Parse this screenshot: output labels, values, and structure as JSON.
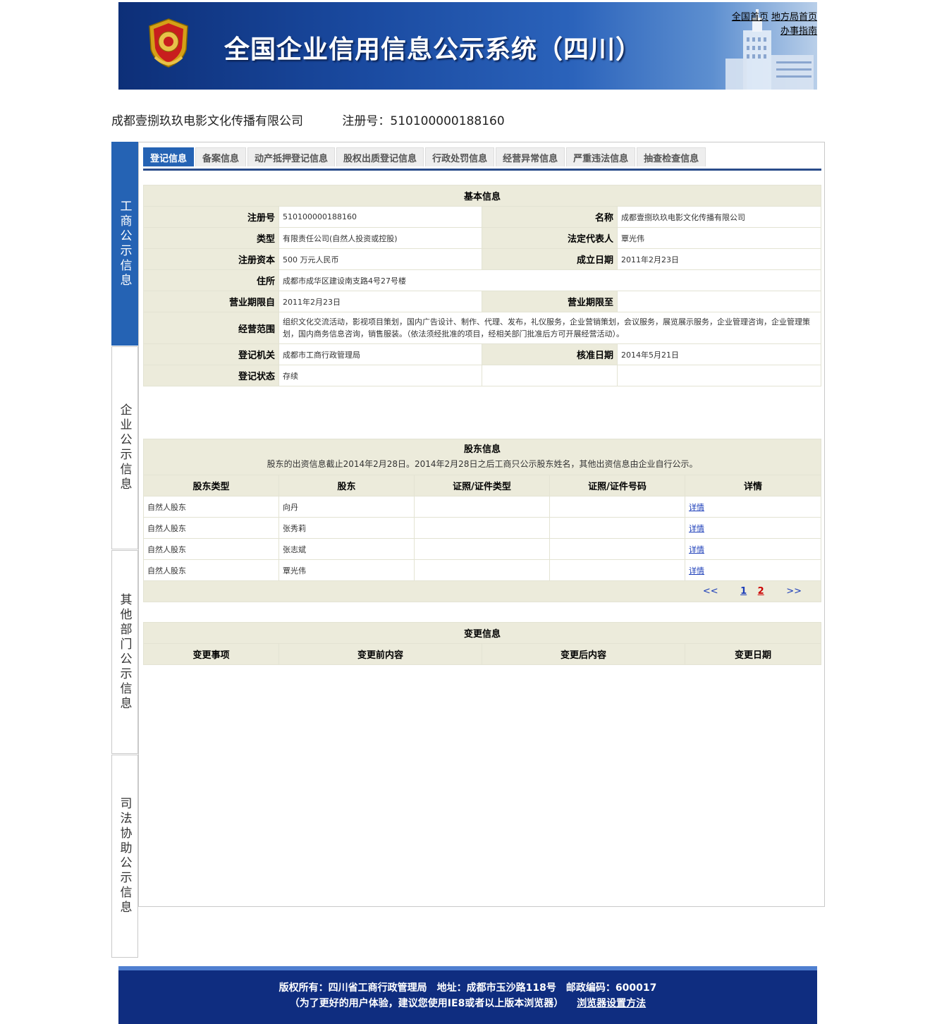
{
  "header": {
    "title": "全国企业信用信息公示系统（四川）",
    "links": [
      "全国首页",
      "地方局首页",
      "办事指南"
    ]
  },
  "company": {
    "name": "成都壹捌玖玖电影文化传播有限公司",
    "reg_label": "注册号：510100000188160"
  },
  "left_tabs": [
    "工商公示信息",
    "企业公示信息",
    "其他部门公示信息",
    "司法协助公示信息"
  ],
  "tabs": [
    "登记信息",
    "备案信息",
    "动产抵押登记信息",
    "股权出质登记信息",
    "行政处罚信息",
    "经营异常信息",
    "严重违法信息",
    "抽查检查信息"
  ],
  "basic": {
    "title": "基本信息",
    "reg_no_label": "注册号",
    "reg_no": "510100000188160",
    "name_label": "名称",
    "name": "成都壹捌玖玖电影文化传播有限公司",
    "type_label": "类型",
    "type": "有限责任公司(自然人投资或控股)",
    "legal_label": "法定代表人",
    "legal": "覃光伟",
    "capital_label": "注册资本",
    "capital": "500 万元人民币",
    "established_label": "成立日期",
    "established": "2011年2月23日",
    "address_label": "住所",
    "address": "成都市成华区建设南支路4号27号楼",
    "term_from_label": "营业期限自",
    "term_from": "2011年2月23日",
    "term_to_label": "营业期限至",
    "term_to": "",
    "scope_label": "经营范围",
    "scope": "组织文化交流活动，影视项目策划，国内广告设计、制作、代理、发布，礼仪服务，企业营销策划，会议服务，展览展示服务，企业管理咨询，企业管理策划，国内商务信息咨询，销售服装。（依法须经批准的项目，经相关部门批准后方可开展经营活动）。",
    "authority_label": "登记机关",
    "authority": "成都市工商行政管理局",
    "approval_label": "核准日期",
    "approval": "2014年5月21日",
    "status_label": "登记状态",
    "status": "存续"
  },
  "shareholders": {
    "title": "股东信息",
    "note": "股东的出资信息截止2014年2月28日。2014年2月28日之后工商只公示股东姓名，其他出资信息由企业自行公示。",
    "headers": [
      "股东类型",
      "股东",
      "证照/证件类型",
      "证照/证件号码",
      "详情"
    ],
    "rows": [
      {
        "type": "自然人股东",
        "name": "向丹",
        "id_type": "",
        "id_no": "",
        "detail": "详情"
      },
      {
        "type": "自然人股东",
        "name": "张秀莉",
        "id_type": "",
        "id_no": "",
        "detail": "详情"
      },
      {
        "type": "自然人股东",
        "name": "张志斌",
        "id_type": "",
        "id_no": "",
        "detail": "详情"
      },
      {
        "type": "自然人股东",
        "name": "覃光伟",
        "id_type": "",
        "id_no": "",
        "detail": "详情"
      }
    ],
    "pager": {
      "prev": "<<",
      "p1": "1",
      "p2": "2",
      "next": ">>"
    }
  },
  "changes": {
    "title": "变更信息",
    "headers": [
      "变更事项",
      "变更前内容",
      "变更后内容",
      "变更日期"
    ]
  },
  "footer": {
    "line1": "版权所有：四川省工商行政管理局　地址：成都市玉沙路118号　邮政编码：600017",
    "line2": "（为了更好的用户体验，建议您使用IE8或者以上版本浏览器）",
    "link": "浏览器设置方法"
  },
  "colors": {
    "header_blue": "#1a4aa0",
    "active_tab": "#2563b4",
    "table_head_bg": "#ecebdb",
    "footer_bg": "#0f2d80"
  }
}
